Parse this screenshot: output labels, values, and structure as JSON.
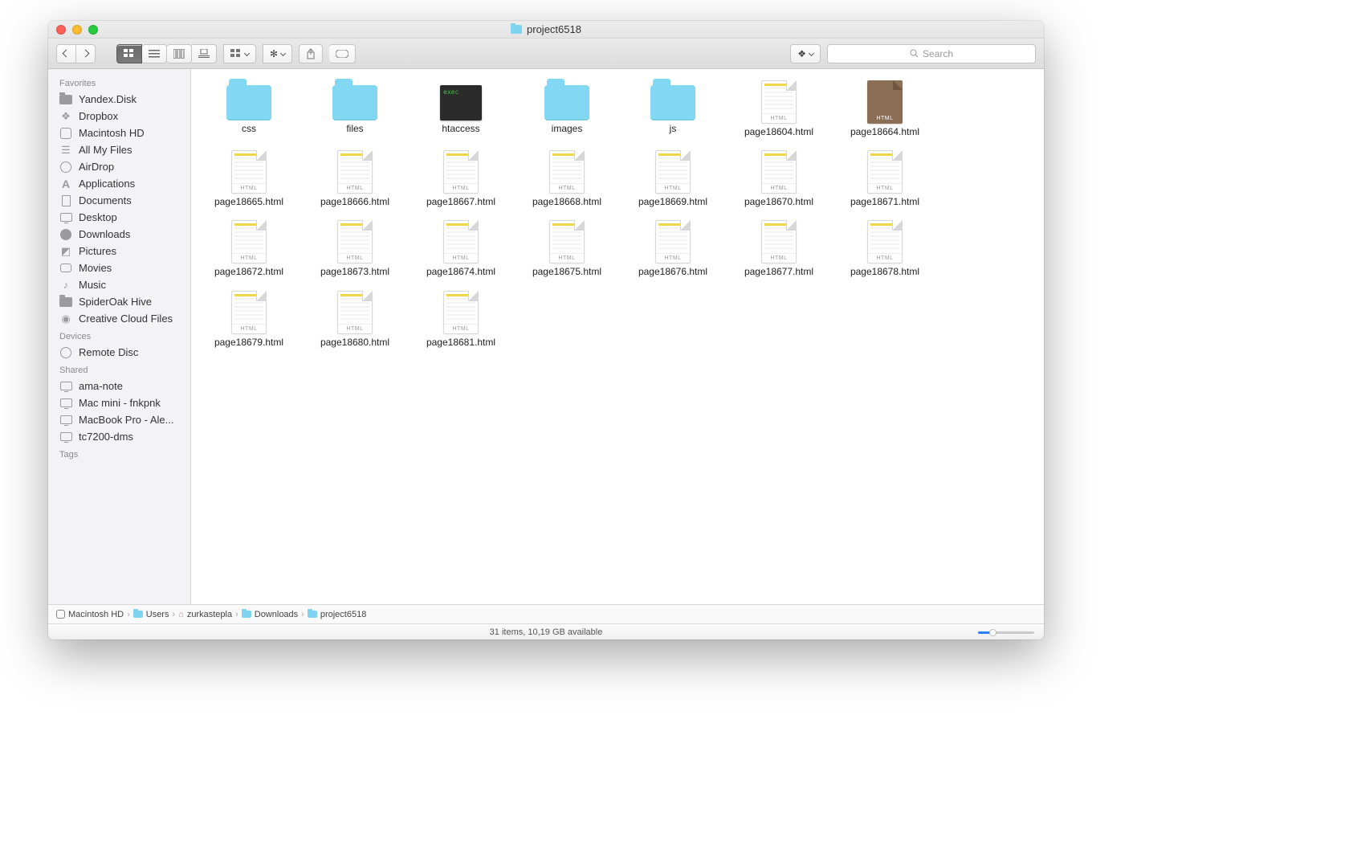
{
  "window": {
    "title": "project6518"
  },
  "toolbar": {
    "dropbox_label": "",
    "search_placeholder": "Search"
  },
  "sidebar": {
    "sections": [
      {
        "header": "Favorites",
        "items": [
          {
            "label": "Yandex.Disk",
            "icon": "folder"
          },
          {
            "label": "Dropbox",
            "icon": "dropbox"
          },
          {
            "label": "Macintosh HD",
            "icon": "disk"
          },
          {
            "label": "All My Files",
            "icon": "allfiles"
          },
          {
            "label": "AirDrop",
            "icon": "airdrop"
          },
          {
            "label": "Applications",
            "icon": "apps"
          },
          {
            "label": "Documents",
            "icon": "docs"
          },
          {
            "label": "Desktop",
            "icon": "desktop"
          },
          {
            "label": "Downloads",
            "icon": "downloads"
          },
          {
            "label": "Pictures",
            "icon": "pictures"
          },
          {
            "label": "Movies",
            "icon": "movies"
          },
          {
            "label": "Music",
            "icon": "music"
          },
          {
            "label": "SpiderOak Hive",
            "icon": "folder"
          },
          {
            "label": "Creative Cloud Files",
            "icon": "cc"
          }
        ]
      },
      {
        "header": "Devices",
        "items": [
          {
            "label": "Remote Disc",
            "icon": "disc"
          }
        ]
      },
      {
        "header": "Shared",
        "items": [
          {
            "label": "ama-note",
            "icon": "pc"
          },
          {
            "label": "Mac mini - fnkpnk",
            "icon": "mac"
          },
          {
            "label": "MacBook Pro - Ale...",
            "icon": "mac"
          },
          {
            "label": "tc7200-dms",
            "icon": "pc"
          }
        ]
      },
      {
        "header": "Tags",
        "items": []
      }
    ]
  },
  "files": [
    {
      "name": "css",
      "type": "folder"
    },
    {
      "name": "files",
      "type": "folder"
    },
    {
      "name": "htaccess",
      "type": "exec",
      "exec_label": "exec"
    },
    {
      "name": "images",
      "type": "folder"
    },
    {
      "name": "js",
      "type": "folder"
    },
    {
      "name": "page18604.html",
      "type": "html",
      "tag": "HTML"
    },
    {
      "name": "page18664.html",
      "type": "html-dark",
      "tag": "HTML"
    },
    {
      "name": "page18665.html",
      "type": "html",
      "tag": "HTML"
    },
    {
      "name": "page18666.html",
      "type": "html",
      "tag": "HTML"
    },
    {
      "name": "page18667.html",
      "type": "html",
      "tag": "HTML"
    },
    {
      "name": "page18668.html",
      "type": "html",
      "tag": "HTML"
    },
    {
      "name": "page18669.html",
      "type": "html",
      "tag": "HTML"
    },
    {
      "name": "page18670.html",
      "type": "html",
      "tag": "HTML"
    },
    {
      "name": "page18671.html",
      "type": "html",
      "tag": "HTML"
    },
    {
      "name": "page18672.html",
      "type": "html",
      "tag": "HTML"
    },
    {
      "name": "page18673.html",
      "type": "html",
      "tag": "HTML"
    },
    {
      "name": "page18674.html",
      "type": "html",
      "tag": "HTML"
    },
    {
      "name": "page18675.html",
      "type": "html",
      "tag": "HTML"
    },
    {
      "name": "page18676.html",
      "type": "html",
      "tag": "HTML"
    },
    {
      "name": "page18677.html",
      "type": "html",
      "tag": "HTML"
    },
    {
      "name": "page18678.html",
      "type": "html",
      "tag": "HTML"
    },
    {
      "name": "page18679.html",
      "type": "html",
      "tag": "HTML"
    },
    {
      "name": "page18680.html",
      "type": "html",
      "tag": "HTML"
    },
    {
      "name": "page18681.html",
      "type": "html",
      "tag": "HTML"
    }
  ],
  "pathbar": [
    {
      "label": "Macintosh HD",
      "icon": "disk"
    },
    {
      "label": "Users",
      "icon": "folder"
    },
    {
      "label": "zurkastepla",
      "icon": "home"
    },
    {
      "label": "Downloads",
      "icon": "folder"
    },
    {
      "label": "project6518",
      "icon": "folder"
    }
  ],
  "status": {
    "text": "31 items, 10,19 GB available"
  }
}
